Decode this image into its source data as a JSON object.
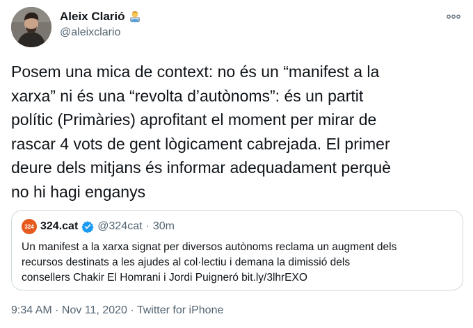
{
  "author": {
    "display_name": "Aleix Clarió",
    "emoji_icon": "technologist-emoji",
    "handle": "@aleixclario"
  },
  "menu": {
    "more_label": "∘∘∘"
  },
  "tweet": {
    "text": "Posem una mica de context: no és un “manifest a la\nxarxa” ni és una “revolta d’autònoms”: és un partit\npolític (Primàries) aprofitant el moment per mirar de\nrascar 4 vots de gent lògicament cabrejada. El primer\ndeure dels mitjans és informar adequadament perquè\nno hi hagi enganys"
  },
  "quote": {
    "logo_text": "324",
    "name": "324.cat",
    "verified_icon": "verified-badge-icon",
    "handle": "@324cat",
    "dot": "·",
    "time": "30m",
    "text": "Un manifest a la xarxa signat per diversos autònoms reclama un augment dels\nrecursos destinats a les ajudes al col·lectiu i demana la dimissió dels\nconsellers Chakir El Homrani i Jordi Puigneró bit.ly/3lhrEXO"
  },
  "footer": {
    "time": "9:34 AM",
    "sep1": " · ",
    "date": "Nov 11, 2020",
    "sep2": " · ",
    "source": "Twitter for iPhone"
  },
  "colors": {
    "text": "#0f1419",
    "secondary": "#536471",
    "border": "#cfd9de",
    "verified": "#1d9bf0",
    "logo": "#e65a1e"
  }
}
